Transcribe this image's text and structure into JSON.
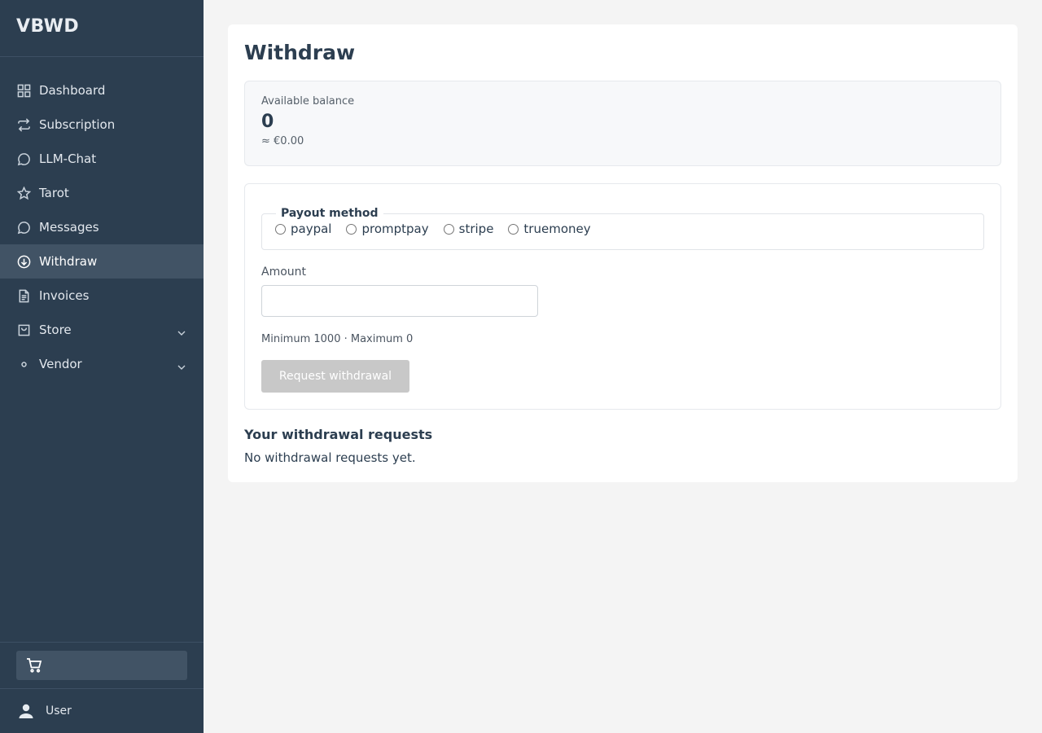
{
  "app": {
    "title": "VBWD"
  },
  "sidebar": {
    "items": [
      {
        "label": "Dashboard",
        "icon": "grid-icon"
      },
      {
        "label": "Subscription",
        "icon": "repeat-icon"
      },
      {
        "label": "LLM-Chat",
        "icon": "chat-bubble-icon"
      },
      {
        "label": "Tarot",
        "icon": "star-icon"
      },
      {
        "label": "Messages",
        "icon": "chat-bubble-icon"
      },
      {
        "label": "Withdraw",
        "icon": "arrow-down-circle-icon",
        "active": true
      },
      {
        "label": "Invoices",
        "icon": "document-icon"
      },
      {
        "label": "Store",
        "icon": "bag-icon",
        "expandable": true
      },
      {
        "label": "Vendor",
        "icon": "dot-icon",
        "expandable": true
      }
    ],
    "cart_icon": "cart-icon",
    "user_label": "User",
    "user_icon": "user-icon"
  },
  "main": {
    "title": "Withdraw",
    "balance": {
      "label": "Available balance",
      "value": "0",
      "eur": "≈ €0.00"
    },
    "form": {
      "payout_legend": "Payout method",
      "payout_options": [
        "paypal",
        "promptpay",
        "stripe",
        "truemoney"
      ],
      "amount_label": "Amount",
      "amount_value": "",
      "limits": "Minimum 1000 · Maximum 0",
      "submit_label": "Request withdrawal"
    },
    "requests": {
      "title": "Your withdrawal requests",
      "empty": "No withdrawal requests yet."
    }
  },
  "colors": {
    "sidebar_bg": "#2c3e50",
    "sidebar_active": "#415365",
    "page_bg": "#f4f4f4",
    "disabled_button": "#c8c8c8"
  }
}
